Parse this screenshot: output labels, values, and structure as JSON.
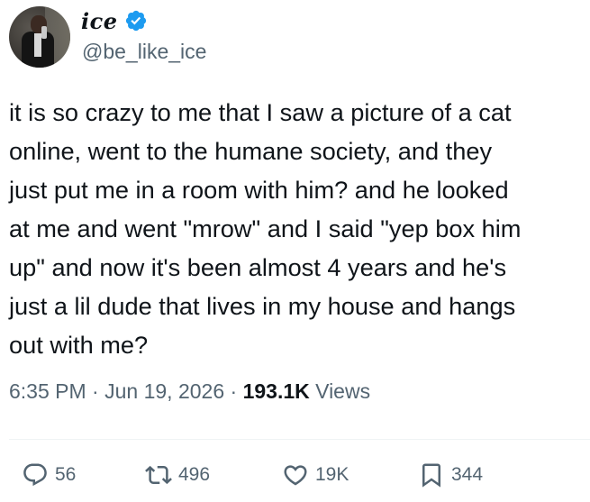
{
  "author": {
    "display_name": "ice",
    "handle": "@be_like_ice",
    "verified_color": "#1d9bf0"
  },
  "tweet": {
    "lines": [
      "it is so crazy to me that I saw a picture of a cat",
      "online, went to the humane society, and they",
      "just put me in a room with him? and he looked",
      "at me and went \"mrow\" and I said \"yep box him",
      "up\" and now it's been almost 4 years and he's",
      "just a lil dude that lives in my house and hangs",
      "out with me?"
    ]
  },
  "meta": {
    "time": "6:35 PM",
    "sep1": " · ",
    "date": "Jun 19, 2026",
    "sep2": " · ",
    "views_count": "193.1K",
    "views_label": " Views"
  },
  "actions": {
    "replies": "56",
    "retweets": "496",
    "likes": "19K",
    "bookmarks": "344",
    "icon_names": [
      "reply-icon",
      "retweet-icon",
      "like-icon",
      "bookmark-icon"
    ]
  }
}
